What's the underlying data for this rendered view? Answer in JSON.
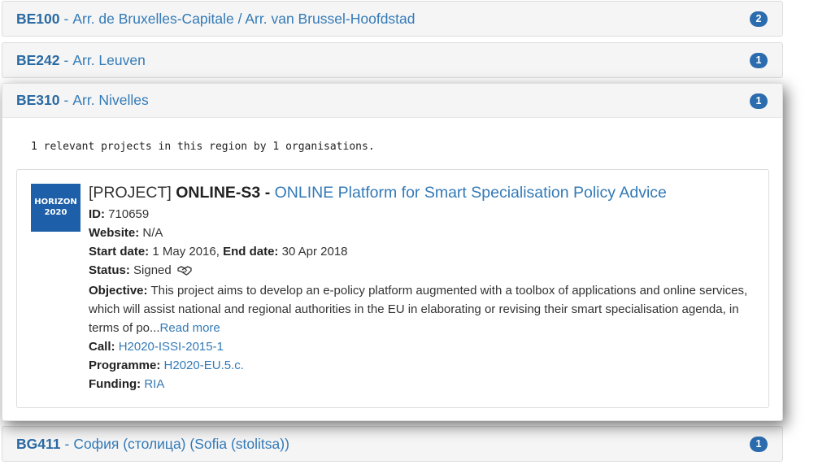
{
  "regions": [
    {
      "code": "BE100",
      "name": "Arr. de Bruxelles-Capitale / Arr. van Brussel-Hoofdstad",
      "count": "2"
    },
    {
      "code": "BE242",
      "name": "Arr. Leuven",
      "count": "1"
    },
    {
      "code": "BE310",
      "name": "Arr. Nivelles",
      "count": "1"
    },
    {
      "code": "BG411",
      "name": "София (столица) (Sofia (stolitsa))",
      "count": "1"
    }
  ],
  "separator": "-",
  "expanded": {
    "summary": "1 relevant projects in this region by 1 organisations.",
    "project": {
      "logo_line1": "HORIZON",
      "logo_line2": "2020",
      "tag": "[PROJECT]",
      "acronym": "ONLINE-S3",
      "title_dash": "-",
      "title": "ONLINE Platform for Smart Specialisation Policy Advice",
      "id_label": "ID:",
      "id": "710659",
      "website_label": "Website:",
      "website": "N/A",
      "start_label": "Start date:",
      "start": "1 May 2016,",
      "end_label": "End date:",
      "end": "30 Apr 2018",
      "status_label": "Status:",
      "status": "Signed",
      "status_icon": "handshake-icon",
      "objective_label": "Objective:",
      "objective": "This project aims to develop an e-policy platform augmented with a toolbox of applications and online services, which will assist national and regional authorities in the EU in elaborating or revising their smart specialisation agenda, in terms of po...",
      "read_more": "Read more",
      "call_label": "Call:",
      "call": "H2020-ISSI-2015-1",
      "programme_label": "Programme:",
      "programme": "H2020-EU.5.c.",
      "funding_label": "Funding:",
      "funding": "RIA"
    }
  },
  "colors": {
    "link": "#337ab7",
    "badge": "#2b6cae",
    "logo": "#1d5fa8",
    "panel_bg": "#f5f5f5"
  }
}
